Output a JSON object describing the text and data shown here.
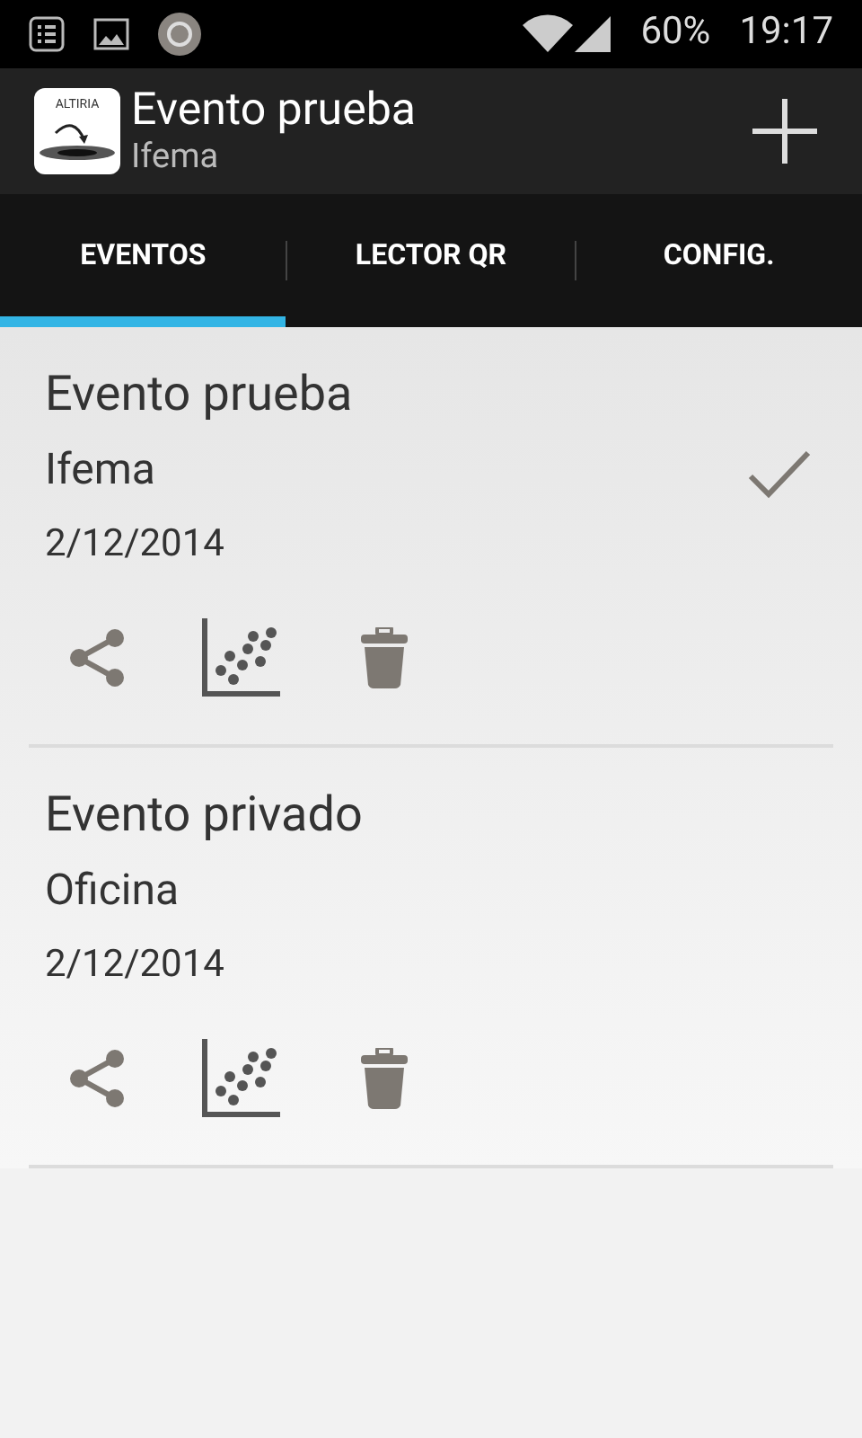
{
  "status_bar": {
    "battery": "60%",
    "time": "19:17"
  },
  "action_bar": {
    "logo_text": "ALTIRIA",
    "title": "Evento prueba",
    "subtitle": "Ifema"
  },
  "tabs": [
    {
      "label": "EVENTOS",
      "selected": true
    },
    {
      "label": "LECTOR QR",
      "selected": false
    },
    {
      "label": "CONFIG.",
      "selected": false
    }
  ],
  "events": [
    {
      "name": "Evento prueba",
      "venue": "Ifema",
      "date": "2/12/2014",
      "checked": true
    },
    {
      "name": "Evento privado",
      "venue": "Oficina",
      "date": "2/12/2014",
      "checked": false
    }
  ]
}
